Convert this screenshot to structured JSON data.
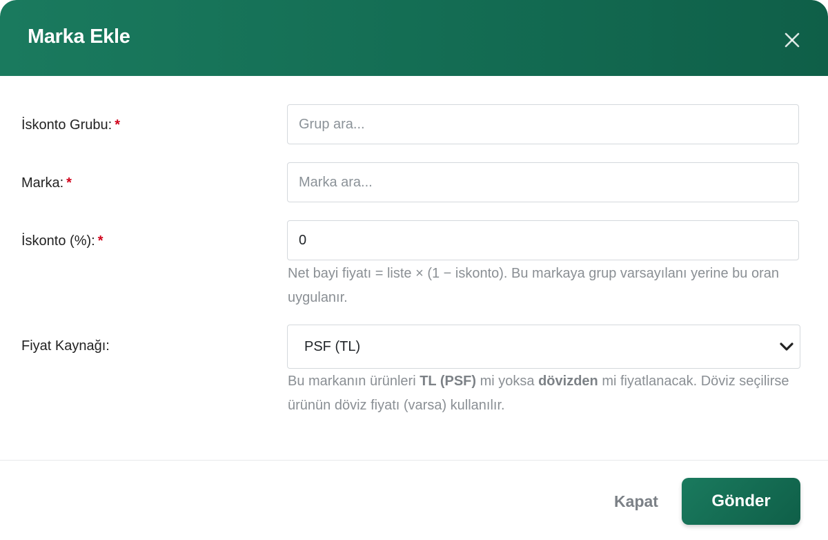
{
  "modal": {
    "title": "Marka Ekle",
    "close_icon": "close-icon"
  },
  "fields": {
    "discount_group": {
      "label": "İskonto Grubu:",
      "required_mark": "*",
      "placeholder": "Grup ara...",
      "value": ""
    },
    "brand": {
      "label": "Marka:",
      "required_mark": "*",
      "placeholder": "Marka ara...",
      "value": ""
    },
    "discount_percent": {
      "label": "İskonto (%):",
      "required_mark": "*",
      "value": "0",
      "help": "Net bayi fiyatı = liste × (1 − iskonto). Bu markaya grup varsayılanı yerine bu oran uygulanır."
    },
    "price_source": {
      "label": "Fiyat Kaynağı:",
      "selected": "PSF (TL)",
      "chevron_icon": "chevron-down-icon",
      "help_part1": "Bu markanın ürünleri ",
      "help_bold1": "TL (PSF)",
      "help_part2": " mi yoksa ",
      "help_bold2": "dövizden",
      "help_part3": " mi fiyatlanacak. Döviz seçilirse ürünün döviz fiyatı (varsa) kullanılır."
    }
  },
  "footer": {
    "close_label": "Kapat",
    "submit_label": "Gönder"
  },
  "colors": {
    "header": "#136b52",
    "required": "#d0021b",
    "muted_text": "#8a8f94"
  }
}
